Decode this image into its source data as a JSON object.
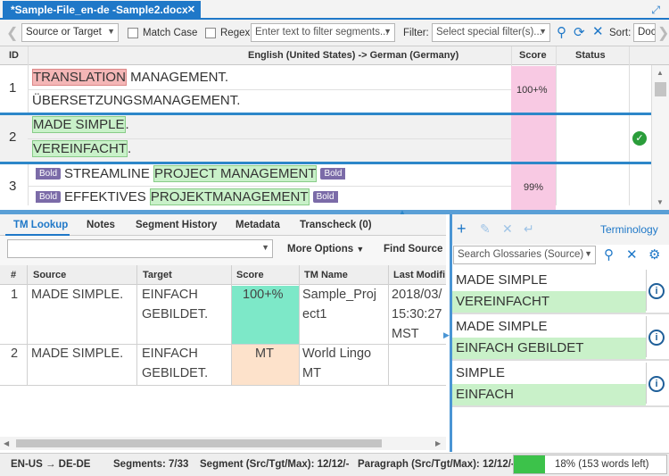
{
  "tab": {
    "title": "*Sample-File_en-de -Sample2.docx",
    "close": "✕"
  },
  "toolbar": {
    "scope": "Source  or  Target",
    "match_case": "Match Case",
    "regex": "Regex",
    "filter_placeholder": "Enter text to filter segments...",
    "filter_label": "Filter:",
    "special_filter": "Select special filter(s)...",
    "sort_label": "Sort:",
    "sort_value": "Doc"
  },
  "grid": {
    "headers": {
      "id": "ID",
      "lang": "English (United States) -> German (Germany)",
      "score": "Score",
      "status": "Status"
    },
    "rows": [
      {
        "id": "1",
        "src_hl": "TRANSLATION",
        "src_rest": " MANAGEMENT.",
        "tgt": "ÜBERSETZUNGSMANAGEMENT.",
        "score": "100+%"
      },
      {
        "id": "2",
        "src": "MADE SIMPLE",
        "src_end": ".",
        "tgt": "VEREINFACHT",
        "tgt_end": ".",
        "score": ""
      },
      {
        "id": "3",
        "tag": "Bold",
        "src_plain": "STREAMLINE ",
        "src_hl": "PROJECT MANAGEMENT",
        "tgt_plain": "EFFEKTIVES ",
        "tgt_hl": "PROJEKTMANAGEMENT",
        "score": "99%"
      }
    ]
  },
  "lower_tabs": [
    "TM Lookup",
    "Notes",
    "Segment History",
    "Metadata",
    "Transcheck (0)"
  ],
  "tm": {
    "more_options": "More Options",
    "find_source": "Find Source",
    "headers": [
      "#",
      "Source",
      "Target",
      "Score",
      "TM Name",
      "Last Modifi"
    ],
    "rows": [
      {
        "n": "1",
        "source": "MADE SIMPLE.",
        "target_1": "EINFACH",
        "target_2": "GEBILDET.",
        "score": "100+%",
        "tm_1": "Sample_Proj",
        "tm_2": "ect1",
        "date_1": "2018/03/",
        "date_2": "15:30:27",
        "date_3": "MST"
      },
      {
        "n": "2",
        "source": "MADE SIMPLE.",
        "target_1": "EINFACH",
        "target_2": "GEBILDET.",
        "score": "MT",
        "tm_1": "World Lingo",
        "tm_2": "MT"
      }
    ]
  },
  "terminology": {
    "title": "Terminology",
    "search_placeholder": "Search Glossaries (Source)",
    "entries": [
      {
        "source": "MADE SIMPLE",
        "target": "VEREINFACHT"
      },
      {
        "source": "MADE SIMPLE",
        "target": "EINFACH GEBILDET"
      },
      {
        "source": "SIMPLE",
        "target": "EINFACH"
      }
    ]
  },
  "status": {
    "lang": "EN-US → DE-DE",
    "segments": "Segments: 7/33",
    "segment": "Segment (Src/Tgt/Max): 12/12/-",
    "paragraph": "Paragraph (Src/Tgt/Max): 12/12/-",
    "progress": "18% (153 words left)",
    "progress_value": 0.18
  },
  "colors": {
    "accent": "#1f78c8",
    "match_green": "#c9f1c9",
    "score_pink": "#f8c9e3",
    "tm_mt": "#fde2cb",
    "tm_exact": "#7de8c8"
  }
}
